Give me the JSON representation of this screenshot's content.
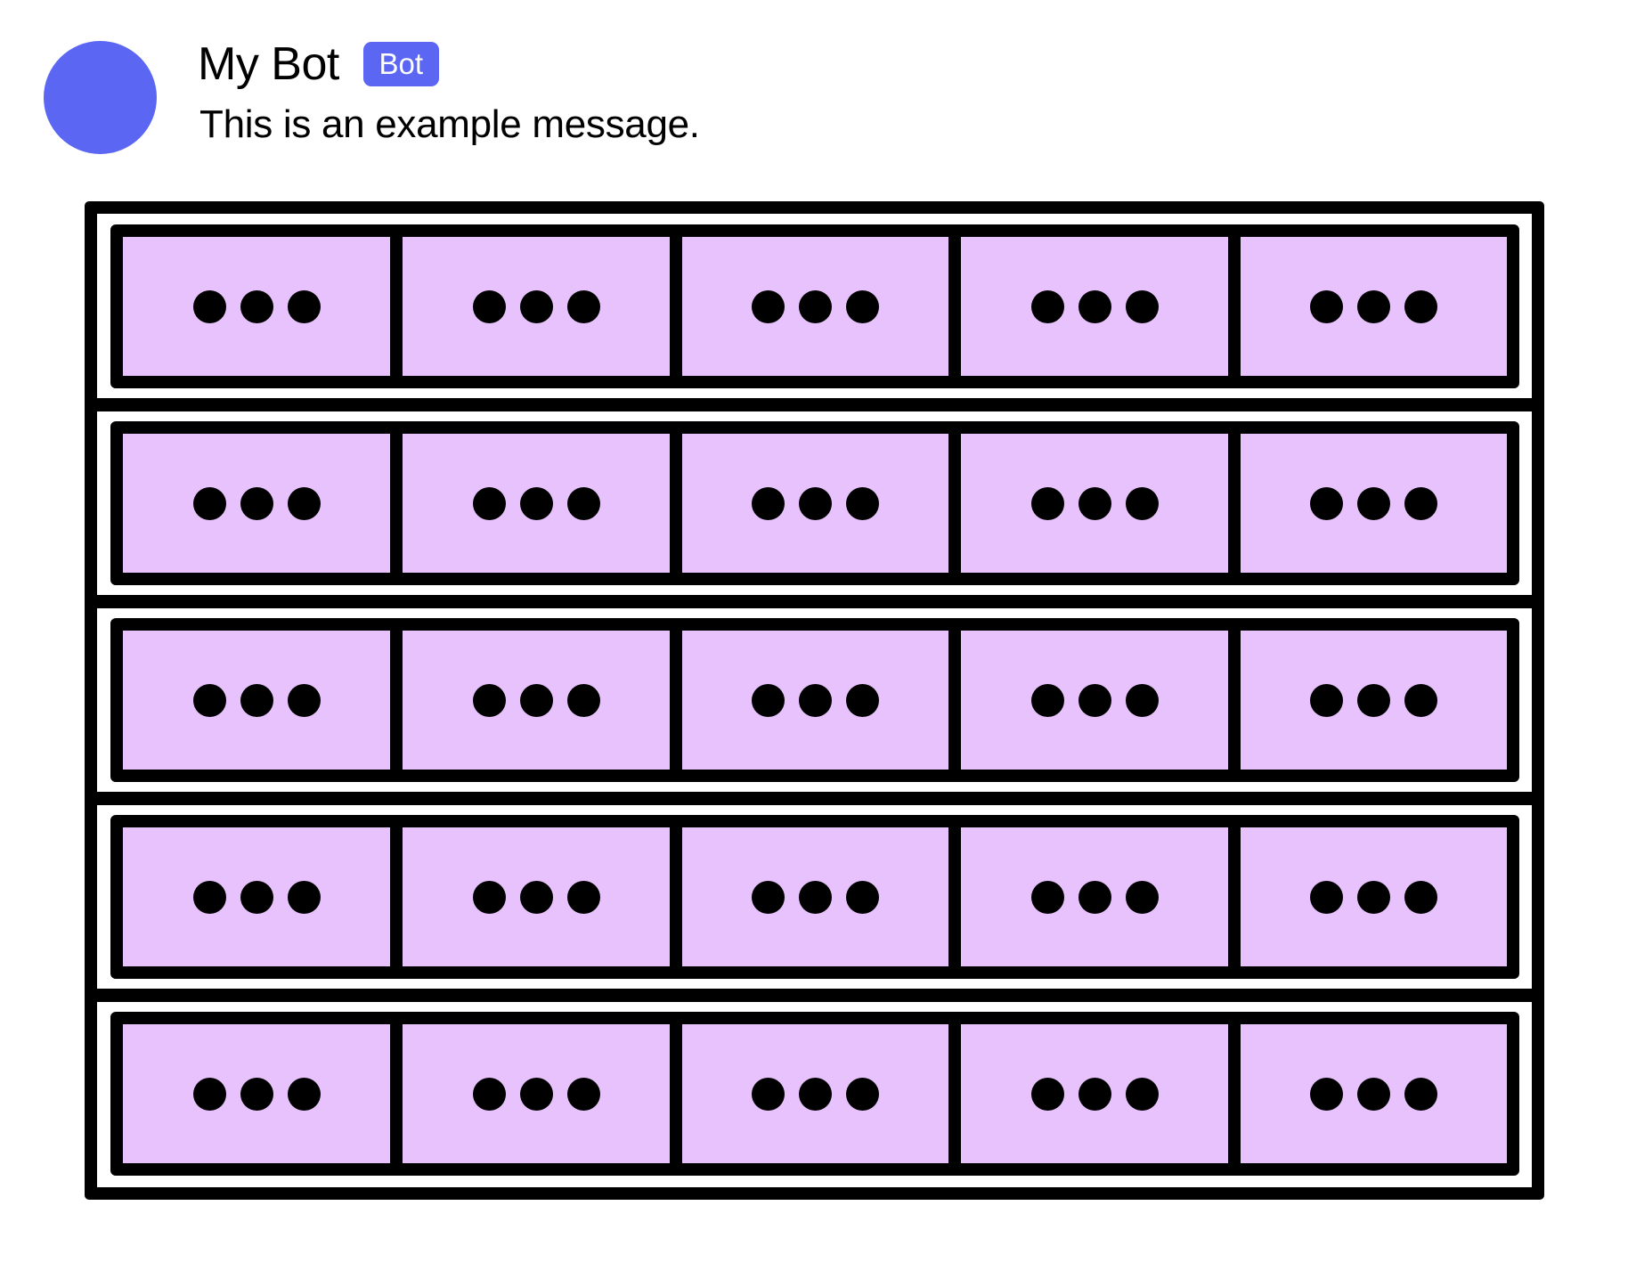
{
  "message": {
    "author": {
      "name": "My Bot",
      "badge": "Bot",
      "avatar_color": "#5b67f3"
    },
    "content": "This is an example message."
  },
  "components": {
    "button_fill_color": "#e8c2fd",
    "border_color": "#000000",
    "rows": [
      {
        "buttons": [
          {
            "label": "...",
            "icon": "ellipsis-icon"
          },
          {
            "label": "...",
            "icon": "ellipsis-icon"
          },
          {
            "label": "...",
            "icon": "ellipsis-icon"
          },
          {
            "label": "...",
            "icon": "ellipsis-icon"
          },
          {
            "label": "...",
            "icon": "ellipsis-icon"
          }
        ]
      },
      {
        "buttons": [
          {
            "label": "...",
            "icon": "ellipsis-icon"
          },
          {
            "label": "...",
            "icon": "ellipsis-icon"
          },
          {
            "label": "...",
            "icon": "ellipsis-icon"
          },
          {
            "label": "...",
            "icon": "ellipsis-icon"
          },
          {
            "label": "...",
            "icon": "ellipsis-icon"
          }
        ]
      },
      {
        "buttons": [
          {
            "label": "...",
            "icon": "ellipsis-icon"
          },
          {
            "label": "...",
            "icon": "ellipsis-icon"
          },
          {
            "label": "...",
            "icon": "ellipsis-icon"
          },
          {
            "label": "...",
            "icon": "ellipsis-icon"
          },
          {
            "label": "...",
            "icon": "ellipsis-icon"
          }
        ]
      },
      {
        "buttons": [
          {
            "label": "...",
            "icon": "ellipsis-icon"
          },
          {
            "label": "...",
            "icon": "ellipsis-icon"
          },
          {
            "label": "...",
            "icon": "ellipsis-icon"
          },
          {
            "label": "...",
            "icon": "ellipsis-icon"
          },
          {
            "label": "...",
            "icon": "ellipsis-icon"
          }
        ]
      },
      {
        "buttons": [
          {
            "label": "...",
            "icon": "ellipsis-icon"
          },
          {
            "label": "...",
            "icon": "ellipsis-icon"
          },
          {
            "label": "...",
            "icon": "ellipsis-icon"
          },
          {
            "label": "...",
            "icon": "ellipsis-icon"
          },
          {
            "label": "...",
            "icon": "ellipsis-icon"
          }
        ]
      }
    ]
  }
}
